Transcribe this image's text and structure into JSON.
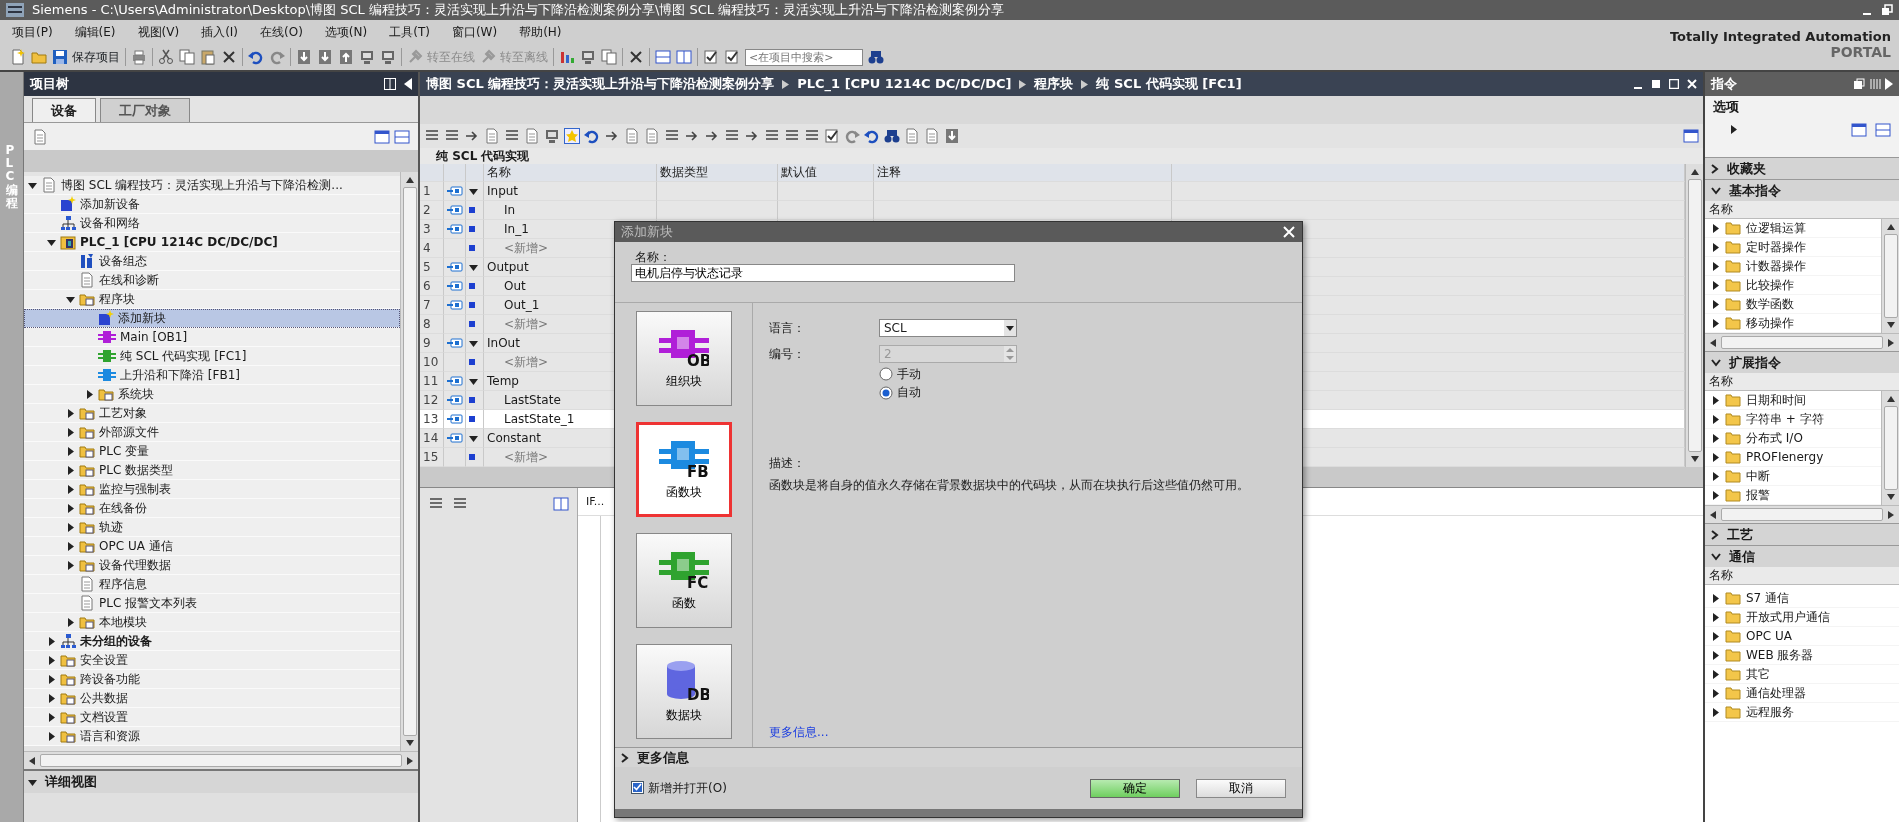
{
  "window": {
    "title": "Siemens  -  C:\\Users\\Administrator\\Desktop\\博图 SCL 编程技巧：灵活实现上升沿与下降沿检测案例分享\\博图 SCL 编程技巧：灵活实现上升沿与下降沿检测案例分享"
  },
  "menu": [
    "项目(P)",
    "编辑(E)",
    "视图(V)",
    "插入(I)",
    "在线(O)",
    "选项(N)",
    "工具(T)",
    "窗口(W)",
    "帮助(H)"
  ],
  "toolbar": {
    "save_label": "保存项目",
    "go_online": {
      "label": "转至在线",
      "disabled": true
    },
    "go_offline": {
      "label": "转至离线",
      "disabled": true
    },
    "search": {
      "placeholder": "<在项目中搜索>"
    }
  },
  "branding": {
    "line1": "Totally Integrated Automation",
    "line2": "PORTAL"
  },
  "side_tab": "PLC 编程",
  "project_tree": {
    "title": "项目树",
    "tabs": [
      {
        "label": "设备",
        "selected": true
      },
      {
        "label": "工厂对象",
        "selected": false
      }
    ],
    "items": [
      {
        "label": "博图 SCL 编程技巧：灵活实现上升沿与下降沿检测...",
        "kind": "document",
        "expanded": true,
        "selected": false,
        "children": [
          {
            "label": "添加新设备",
            "kind": "add",
            "selected": false
          },
          {
            "label": "设备和网络",
            "kind": "network",
            "selected": false
          },
          {
            "label": "PLC_1 [CPU 1214C DC/DC/DC]",
            "kind": "device",
            "bold": true,
            "expanded": true,
            "selected": false,
            "children": [
              {
                "label": "设备组态",
                "kind": "tool",
                "selected": false
              },
              {
                "label": "在线和诊断",
                "kind": "document",
                "selected": false
              },
              {
                "label": "程序块",
                "kind": "folder",
                "expanded": true,
                "selected": false,
                "children": [
                  {
                    "label": "添加新块",
                    "kind": "add",
                    "selected": true
                  },
                  {
                    "label": "Main [OB1]",
                    "kind": "block",
                    "color": "#b01fd8",
                    "selected": false
                  },
                  {
                    "label": "纯 SCL 代码实现 [FC1]",
                    "kind": "block",
                    "color": "#2fa32f",
                    "selected": false
                  },
                  {
                    "label": "上升沿和下降沿 [FB1]",
                    "kind": "block",
                    "color": "#1c8ae0",
                    "selected": false
                  },
                  {
                    "label": "系统块",
                    "kind": "folder",
                    "expanded": false,
                    "selected": false
                  }
                ]
              },
              {
                "label": "工艺对象",
                "kind": "folder",
                "expanded": false,
                "selected": false
              },
              {
                "label": "外部源文件",
                "kind": "folder",
                "expanded": false,
                "selected": false
              },
              {
                "label": "PLC 变量",
                "kind": "folder",
                "expanded": false,
                "selected": false
              },
              {
                "label": "PLC 数据类型",
                "kind": "folder",
                "expanded": false,
                "selected": false
              },
              {
                "label": "监控与强制表",
                "kind": "folder",
                "expanded": false,
                "selected": false
              },
              {
                "label": "在线备份",
                "kind": "folder",
                "expanded": false,
                "selected": false
              },
              {
                "label": "轨迹",
                "kind": "folder",
                "expanded": false,
                "selected": false
              },
              {
                "label": "OPC UA 通信",
                "kind": "folder",
                "expanded": false,
                "selected": false
              },
              {
                "label": "设备代理数据",
                "kind": "folder",
                "expanded": false,
                "selected": false
              },
              {
                "label": "程序信息",
                "kind": "document",
                "selected": false
              },
              {
                "label": "PLC 报警文本列表",
                "kind": "document",
                "selected": false
              },
              {
                "label": "本地模块",
                "kind": "folder",
                "expanded": false,
                "selected": false
              }
            ]
          },
          {
            "label": "未分组的设备",
            "kind": "network",
            "bold": true,
            "expanded": false,
            "selected": false
          },
          {
            "label": "安全设置",
            "kind": "folder",
            "expanded": false,
            "selected": false
          },
          {
            "label": "跨设备功能",
            "kind": "folder",
            "expanded": false,
            "selected": false
          },
          {
            "label": "公共数据",
            "kind": "folder",
            "expanded": false,
            "selected": false
          },
          {
            "label": "文档设置",
            "kind": "folder",
            "expanded": false,
            "selected": false
          },
          {
            "label": "语言和资源",
            "kind": "folder",
            "expanded": false,
            "selected": false
          }
        ]
      }
    ]
  },
  "details_view": {
    "title": "详细视图",
    "expanded": true
  },
  "editor": {
    "breadcrumb": [
      "博图 SCL 编程技巧：灵活实现上升沿与下降沿检测案例分享",
      "PLC_1 [CPU 1214C DC/DC/DC]",
      "程序块",
      "纯 SCL 代码实现 [FC1]"
    ],
    "block_title": "纯 SCL 代码实现",
    "columns": [
      "名称",
      "数据类型",
      "默认值",
      "注释"
    ],
    "rows": [
      {
        "number": "1",
        "kind": "section",
        "name": "Input",
        "expanded": true,
        "selected": false
      },
      {
        "number": "2",
        "kind": "variable",
        "name": "In",
        "selected": false
      },
      {
        "number": "3",
        "kind": "variable",
        "name": "In_1",
        "selected": false
      },
      {
        "number": "4",
        "kind": "add",
        "name": "<新增>",
        "selected": false
      },
      {
        "number": "5",
        "kind": "section",
        "name": "Output",
        "expanded": true,
        "selected": false
      },
      {
        "number": "6",
        "kind": "variable",
        "name": "Out",
        "selected": false
      },
      {
        "number": "7",
        "kind": "variable",
        "name": "Out_1",
        "selected": false
      },
      {
        "number": "8",
        "kind": "add",
        "name": "<新增>",
        "selected": false
      },
      {
        "number": "9",
        "kind": "section",
        "name": "InOut",
        "expanded": true,
        "selected": false
      },
      {
        "number": "10",
        "kind": "add",
        "name": "<新增>",
        "selected": false
      },
      {
        "number": "11",
        "kind": "section",
        "name": "Temp",
        "expanded": true,
        "selected": false
      },
      {
        "number": "12",
        "kind": "variable",
        "name": "LastState",
        "selected": false
      },
      {
        "number": "13",
        "kind": "variable",
        "name": "LastState_1",
        "selected": true
      },
      {
        "number": "14",
        "kind": "section",
        "name": "Constant",
        "expanded": true,
        "selected": false
      },
      {
        "number": "15",
        "kind": "add",
        "name": "<新增>",
        "selected": false
      }
    ],
    "code_tab": "IF..."
  },
  "instructions": {
    "title": "指令",
    "options_title": "选项",
    "sections": [
      {
        "title": "收藏夹",
        "expanded": false
      },
      {
        "title": "基本指令",
        "expanded": true,
        "column": "名称",
        "items": [
          {
            "label": "位逻辑运算",
            "expanded": false
          },
          {
            "label": "定时器操作",
            "expanded": false
          },
          {
            "label": "计数器操作",
            "expanded": false
          },
          {
            "label": "比较操作",
            "expanded": false
          },
          {
            "label": "数学函数",
            "expanded": false
          },
          {
            "label": "移动操作",
            "expanded": false
          }
        ]
      },
      {
        "title": "扩展指令",
        "expanded": true,
        "column": "名称",
        "items": [
          {
            "label": "日期和时间",
            "expanded": false
          },
          {
            "label": "字符串 + 字符",
            "expanded": false
          },
          {
            "label": "分布式 I/O",
            "expanded": false
          },
          {
            "label": "PROFIenergy",
            "expanded": false
          },
          {
            "label": "中断",
            "expanded": false
          },
          {
            "label": "报警",
            "expanded": false
          }
        ]
      },
      {
        "title": "工艺",
        "expanded": false
      },
      {
        "title": "通信",
        "expanded": true,
        "column": "名称",
        "items": [
          {
            "label": "S7 通信",
            "expanded": false
          },
          {
            "label": "开放式用户通信",
            "expanded": false
          },
          {
            "label": "OPC UA",
            "expanded": false
          },
          {
            "label": "WEB 服务器",
            "expanded": false
          },
          {
            "label": "其它",
            "expanded": false
          },
          {
            "label": "通信处理器",
            "expanded": false
          },
          {
            "label": "远程服务",
            "expanded": false
          }
        ]
      }
    ]
  },
  "dialog": {
    "title": "添加新块",
    "name_label": "名称：",
    "name_value": "电机启停与状态记录",
    "block_types": [
      {
        "label": "组织块",
        "code": "OB",
        "kind": "connector",
        "color": "#b01fd8",
        "selected": false
      },
      {
        "label": "函数块",
        "code": "FB",
        "kind": "connector",
        "color": "#1c8ae0",
        "selected": true
      },
      {
        "label": "函数",
        "code": "FC",
        "kind": "connector",
        "color": "#2fa32f",
        "selected": false
      },
      {
        "label": "数据块",
        "code": "DB",
        "kind": "cylinder",
        "color": "#5f66e0",
        "selected": false
      }
    ],
    "language": {
      "label": "语言：",
      "value": "SCL"
    },
    "number": {
      "label": "编号：",
      "value": "2",
      "disabled": true
    },
    "numbering": [
      {
        "label": "手动",
        "selected": false
      },
      {
        "label": "自动",
        "selected": true
      }
    ],
    "description_label": "描述：",
    "description": "函数块是将自身的值永久存储在背景数据块中的代码块，从而在块执行后这些值仍然可用。",
    "more_info_link": "更多信息...",
    "more_info_section": {
      "title": "更多信息",
      "expanded": false
    },
    "add_and_open": {
      "label": "新增并打开(O)",
      "checked": true
    },
    "buttons": [
      {
        "label": "确定",
        "kind": "primary"
      },
      {
        "label": "取消",
        "kind": "secondary"
      }
    ]
  }
}
